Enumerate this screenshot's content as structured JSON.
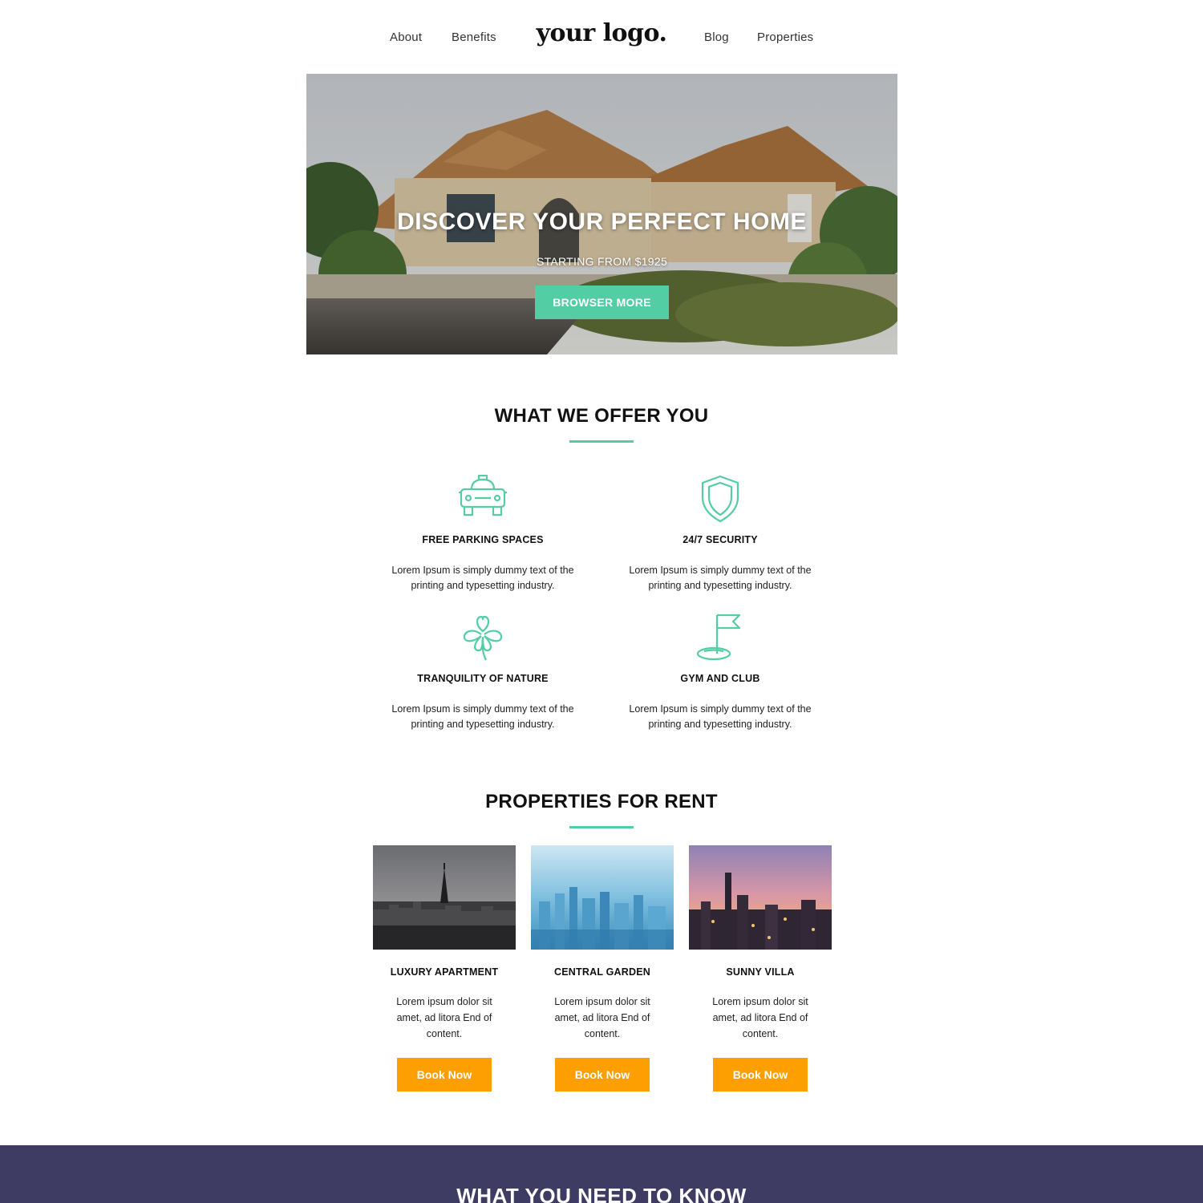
{
  "nav": {
    "links": [
      "About",
      "Benefits",
      "Blog",
      "Properties"
    ],
    "logo": "your logo."
  },
  "hero": {
    "title": "DISCOVER YOUR PERFECT HOME",
    "subtitle": "STARTING FROM $1925",
    "button_label": "BROWSER MORE"
  },
  "offer": {
    "title": "WHAT WE OFFER YOU",
    "features": [
      {
        "title": "FREE PARKING SPACES",
        "text": "Lorem Ipsum is simply dummy text of the printing and typesetting industry.",
        "icon": "car-icon"
      },
      {
        "title": "24/7 SECURITY",
        "text": "Lorem Ipsum is simply dummy text of the printing and typesetting industry.",
        "icon": "shield-icon"
      },
      {
        "title": "TRANQUILITY OF NATURE",
        "text": "Lorem Ipsum is simply dummy text of the printing and typesetting industry.",
        "icon": "clover-icon"
      },
      {
        "title": "GYM AND CLUB",
        "text": "Lorem Ipsum is simply dummy text of the printing and typesetting industry.",
        "icon": "golf-flag-icon"
      }
    ]
  },
  "properties": {
    "title": "PROPERTIES FOR RENT",
    "items": [
      {
        "title": "LUXURY APARTMENT",
        "text": "Lorem ipsum dolor sit amet, ad litora End of content.",
        "button": "Book Now"
      },
      {
        "title": "CENTRAL GARDEN",
        "text": "Lorem ipsum dolor sit amet, ad litora End of content.",
        "button": "Book Now"
      },
      {
        "title": "SUNNY VILLA",
        "text": "Lorem ipsum dolor sit amet, ad litora End of content.",
        "button": "Book Now"
      }
    ]
  },
  "band": {
    "title": "WHAT YOU NEED TO KNOW"
  },
  "colors": {
    "accent": "#53cda4",
    "cta": "#fe9f01",
    "band": "#3e3c63"
  }
}
